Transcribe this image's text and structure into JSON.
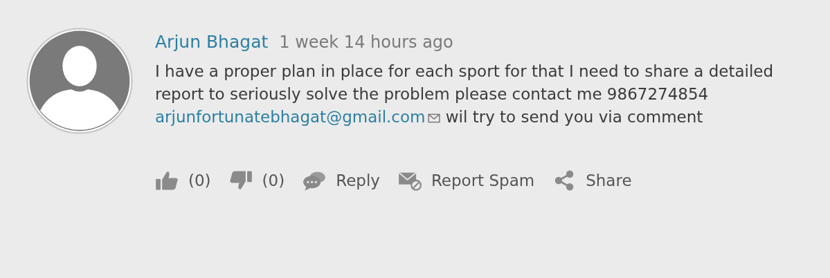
{
  "comment": {
    "author": "Arjun Bhagat",
    "time": "1 week 14 hours ago",
    "body": {
      "before": "I have a proper plan in place for each sport for that I need to share a detailed report to seriously solve the problem please contact me 9867274854",
      "email": "arjunfortunatebhagat@gmail.com",
      "after": "wil try to send you via comment"
    }
  },
  "actions": [
    {
      "kind": "like",
      "label": "(0)"
    },
    {
      "kind": "dislike",
      "label": "(0)"
    },
    {
      "kind": "reply",
      "label": "Reply"
    },
    {
      "kind": "spam",
      "label": "Report Spam"
    },
    {
      "kind": "share",
      "label": "Share"
    }
  ]
}
